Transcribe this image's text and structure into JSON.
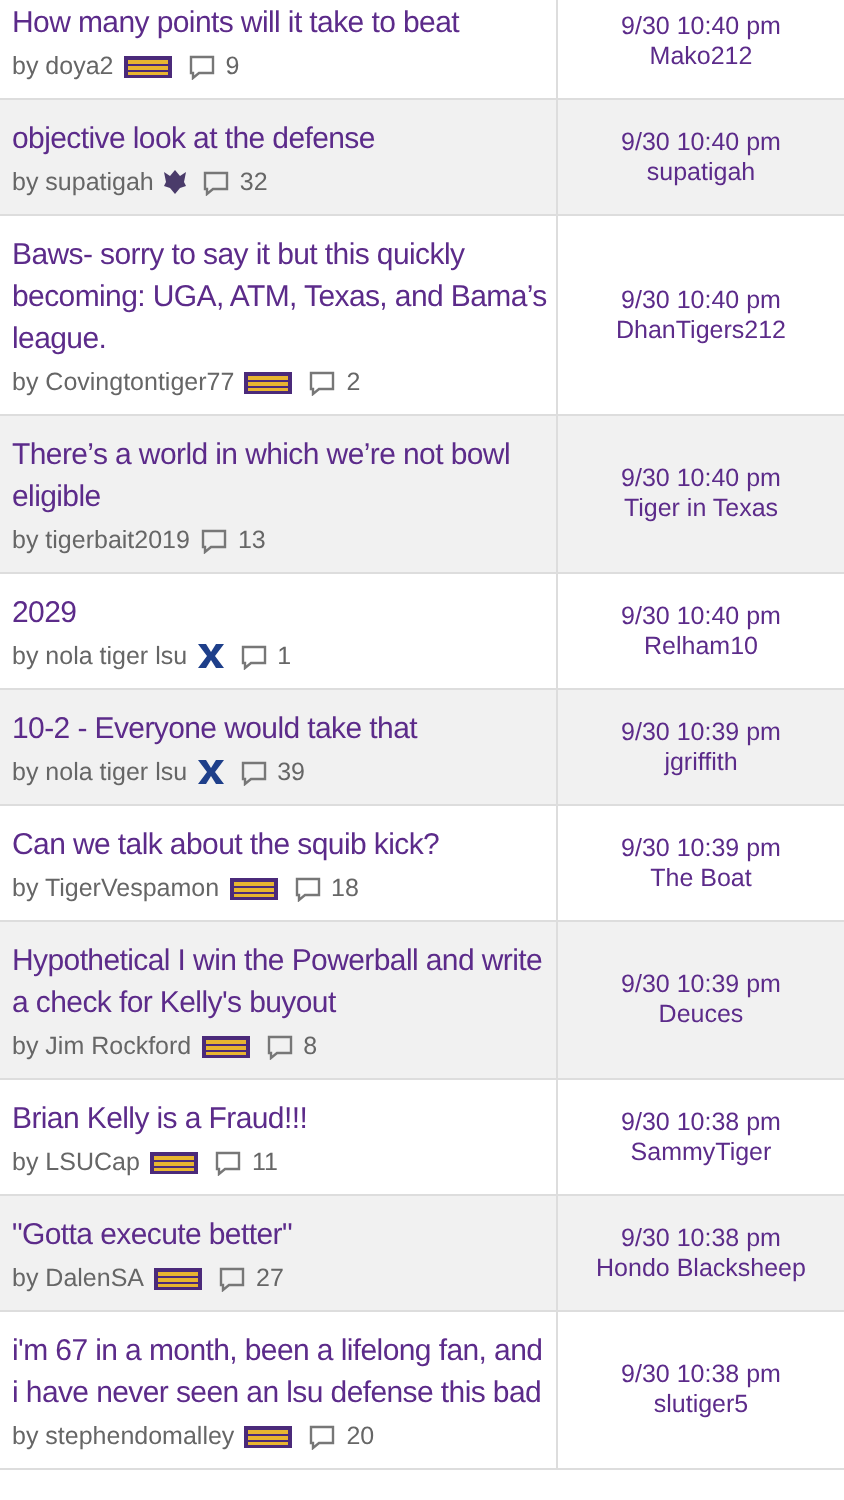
{
  "threads": [
    {
      "title": "How many points will it take to beat",
      "author": "by doya2",
      "kind": "lsu",
      "replies": "9",
      "time": "9/30 10:40 pm",
      "last_poster": "Mako212"
    },
    {
      "title": "objective look at the defense",
      "author": "by supatigah",
      "kind": "crest",
      "replies": "32",
      "time": "9/30 10:40 pm",
      "last_poster": "supatigah"
    },
    {
      "title": "Baws- sorry to say it but this quickly becoming: UGA, ATM, Texas, and Bama’s league.",
      "author": "by Covingtontiger77",
      "kind": "lsu",
      "replies": "2",
      "time": "9/30 10:40 pm",
      "last_poster": "DhanTigers212"
    },
    {
      "title": "There’s a world in which we’re not bowl eligible",
      "author": "by tigerbait2019",
      "replies": "13",
      "time": "9/30 10:40 pm",
      "last_poster": "Tiger in Texas"
    },
    {
      "title": "2029",
      "author": "by nola tiger lsu",
      "kind": "x",
      "replies": "1",
      "time": "9/30 10:40 pm",
      "last_poster": "Relham10"
    },
    {
      "title": "10-2 - Everyone would take that",
      "author": "by nola tiger lsu",
      "kind": "x",
      "replies": "39",
      "time": "9/30 10:39 pm",
      "last_poster": "jgriffith"
    },
    {
      "title": "Can we talk about the squib kick?",
      "author": "by TigerVespamon",
      "kind": "lsu",
      "replies": "18",
      "time": "9/30 10:39 pm",
      "last_poster": "The Boat"
    },
    {
      "title": "Hypothetical I win the Powerball and write a check for Kelly's buyout",
      "author": "by Jim Rockford",
      "kind": "lsu",
      "replies": "8",
      "time": "9/30 10:39 pm",
      "last_poster": "Deuces"
    },
    {
      "title": "Brian Kelly is a Fraud!!!",
      "author": "by LSUCap",
      "kind": "lsu",
      "replies": "11",
      "time": "9/30 10:38 pm",
      "last_poster": "SammyTiger"
    },
    {
      "title": "\"Gotta execute better\"",
      "author": "by DalenSA",
      "kind": "lsu",
      "replies": "27",
      "time": "9/30 10:38 pm",
      "last_poster": "Hondo Blacksheep"
    },
    {
      "title": "i'm 67 in a month, been a lifelong fan, and i have never seen an lsu defense this bad",
      "author": "by stephendomalley",
      "kind": "lsu",
      "replies": "20",
      "time": "9/30 10:38 pm",
      "last_poster": "slutiger5"
    }
  ]
}
